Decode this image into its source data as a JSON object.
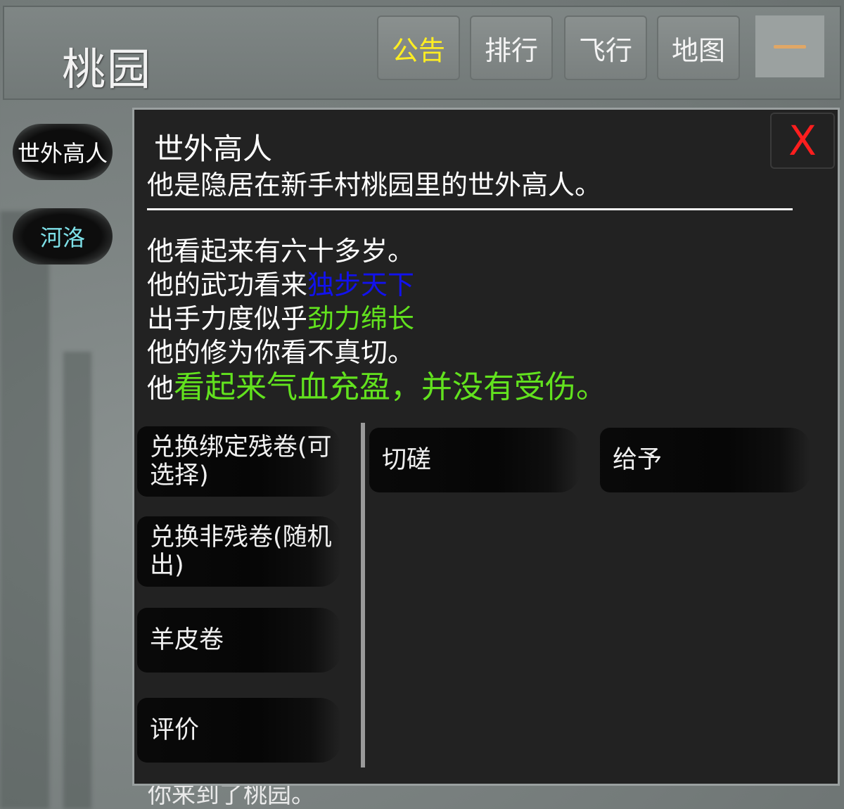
{
  "header": {
    "scene_title": "桃园",
    "buttons": {
      "notice": "公告",
      "ranking": "排行",
      "fly": "飞行",
      "map": "地图"
    },
    "menu_icon": "menu-dash-icon"
  },
  "sidebar": {
    "npcs": [
      {
        "label": "世外高人",
        "color": "#ffffff"
      },
      {
        "label": "河洛",
        "color": "#7ee0e8"
      }
    ]
  },
  "background_text": "你来到了桃园。",
  "dialog": {
    "close_label": "X",
    "npc_name": "世外高人",
    "description": "他是隐居在新手村桃园里的世外高人。",
    "divider": "——————————————————————",
    "age_line": "他看起来有六十多岁。",
    "skill_prefix": "他的武功看来",
    "skill_value": "独步天下",
    "force_prefix": "出手力度似乎",
    "force_value": "劲力绵长",
    "cultivation_line": "他的修为你看不真切。",
    "health_prefix": "他",
    "health_value": "看起来气血充盈，并没有受伤。",
    "actions_left": [
      {
        "label": "兑换绑定残卷(可选择)"
      },
      {
        "label": "兑换非残卷(随机出)"
      },
      {
        "label": "羊皮卷"
      },
      {
        "label": "评价"
      }
    ],
    "actions_right": [
      {
        "label": "切磋"
      },
      {
        "label": "给予"
      }
    ]
  },
  "colors": {
    "notice_yellow": "#ffee22",
    "close_red": "#ff1e1e",
    "skill_blue": "#1212ee",
    "status_green": "#62e21e",
    "npc_cyan": "#7ee0e8",
    "menu_orange": "#e0a766"
  }
}
